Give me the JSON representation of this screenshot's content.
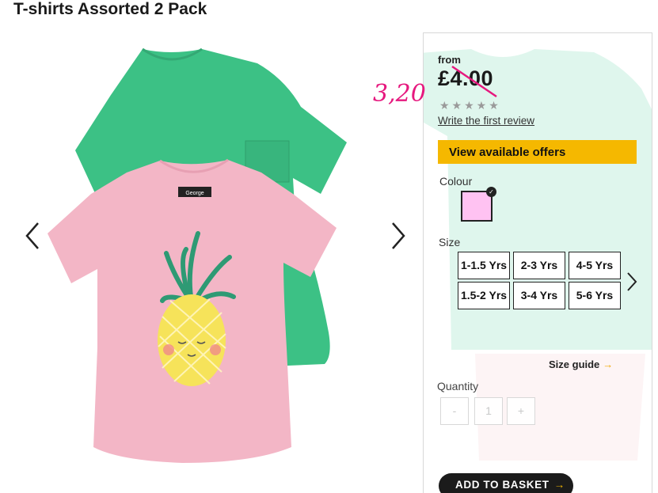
{
  "product": {
    "title": "T-shirts Assorted 2 Pack",
    "tshirt_brand_label": "George"
  },
  "gallery": {
    "prev_icon": "chevron-left-icon",
    "next_icon": "chevron-right-icon"
  },
  "pricing": {
    "from_label": "from",
    "price": "£4.00",
    "handwritten_price": "3,20",
    "rating_stars": "★★★★★",
    "rating_value": 0,
    "review_link": "Write the first review"
  },
  "offers": {
    "label": "View available offers"
  },
  "colour": {
    "label": "Colour",
    "selected_hex": "#ffc2f2"
  },
  "size": {
    "label": "Size",
    "options": [
      "1-1.5 Yrs",
      "2-3 Yrs",
      "4-5 Yrs",
      "1.5-2 Yrs",
      "3-4 Yrs",
      "5-6 Yrs"
    ],
    "guide_label": "Size guide",
    "guide_arrow": "→"
  },
  "quantity": {
    "label": "Quantity",
    "minus": "-",
    "value": "1",
    "plus": "+"
  },
  "basket": {
    "label": "ADD TO BASKET",
    "arrow": "→"
  },
  "colors": {
    "offers_yellow": "#f5b800",
    "annotation_pink": "#e6187e",
    "tshirt_green": "#3cc185",
    "tshirt_pink": "#f3b6c6",
    "pineapple_yellow": "#f6e35a"
  }
}
